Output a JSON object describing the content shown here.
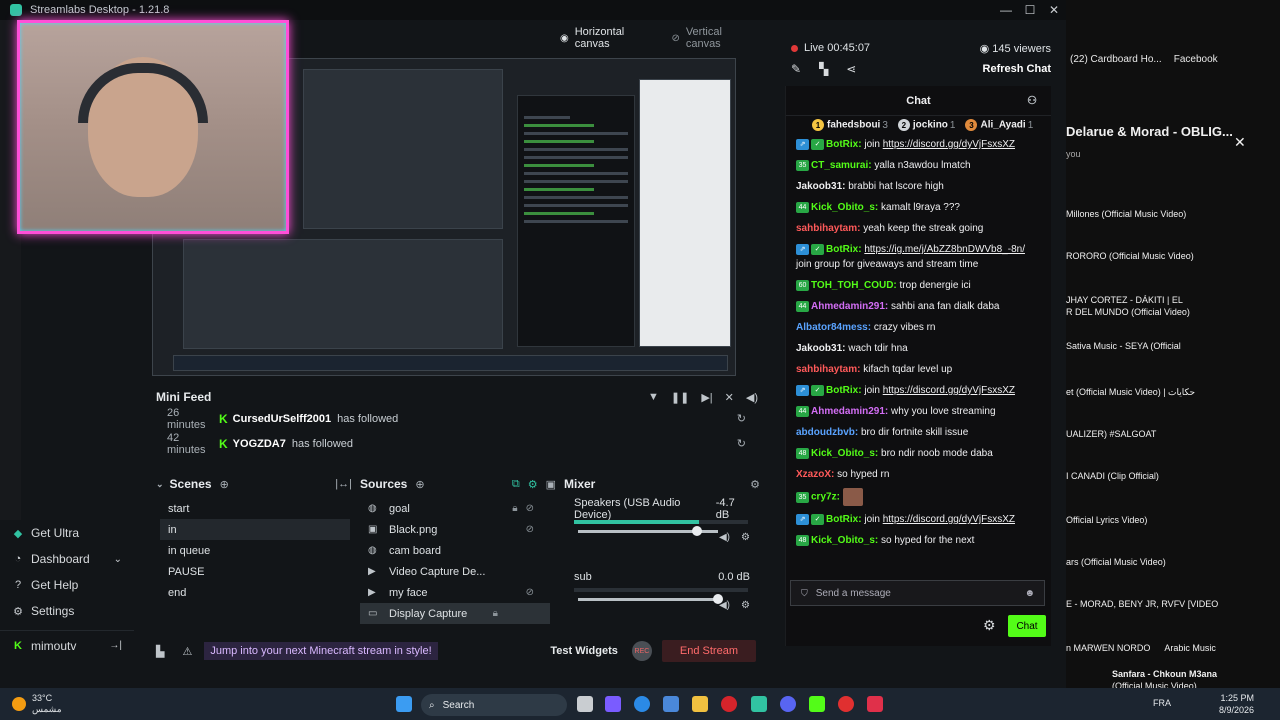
{
  "window": {
    "title": "Streamlabs Desktop - 1.21.8"
  },
  "canvas": {
    "horizontal": "Horizontal canvas",
    "vertical": "Vertical canvas"
  },
  "nav": {
    "items": [
      {
        "label": "Get Ultra",
        "icon": "ultra-icon"
      },
      {
        "label": "Dashboard",
        "icon": "dashboard-icon"
      },
      {
        "label": "Get Help",
        "icon": "help-icon"
      },
      {
        "label": "Settings",
        "icon": "gear-icon"
      }
    ],
    "user": "mimoutv"
  },
  "minifeed": {
    "title": "Mini Feed",
    "rows": [
      {
        "time": "26 minutes",
        "user": "CursedUrSelff2001",
        "action": "has followed"
      },
      {
        "time": "42 minutes",
        "user": "YOGZDA7",
        "action": "has followed"
      }
    ]
  },
  "scenes": {
    "title": "Scenes",
    "items": [
      "start",
      "in",
      "in queue",
      "PAUSE",
      "end"
    ],
    "selected": "in"
  },
  "sources": {
    "title": "Sources",
    "items": [
      "goal",
      "Black.png",
      "cam board",
      "Video Capture De...",
      "my face",
      "Display Capture"
    ],
    "selected": "Display Capture"
  },
  "mixer": {
    "title": "Mixer",
    "channels": [
      {
        "name": "Speakers (USB Audio Device)",
        "db": "-4.7 dB",
        "level": 0.72,
        "volume": 0.85
      },
      {
        "name": "sub",
        "db": "0.0 dB",
        "level": 0.0,
        "volume": 1.0
      }
    ]
  },
  "footer": {
    "promo": "Jump into your next Minecraft stream in style!",
    "test_widgets": "Test Widgets",
    "rec": "REC",
    "end_stream": "End Stream"
  },
  "live": {
    "status": "Live 00:45:07",
    "viewers": "145 viewers",
    "refresh": "Refresh Chat"
  },
  "chat": {
    "title": "Chat",
    "leaders": [
      {
        "rank": "1",
        "name": "fahedsboui",
        "count": "3",
        "color": "#f5c542"
      },
      {
        "rank": "2",
        "name": "jockino",
        "count": "1",
        "color": "#d0d4d8"
      },
      {
        "rank": "3",
        "name": "Ali_Ayadi",
        "count": "1",
        "color": "#e08a3c"
      }
    ],
    "messages": [
      {
        "badge": "",
        "user": "BotRix",
        "color": "#53fc18",
        "text": "join ",
        "link": "https://discord.gg/dyVjFsxsXZ",
        "bot": true
      },
      {
        "badge": "35",
        "user": "CT_samurai",
        "color": "#53fc18",
        "text": "yalla n3awdou lmatch"
      },
      {
        "badge": "",
        "user": "Jakoob31",
        "color": "#efeff1",
        "text": "brabbi hat lscore high"
      },
      {
        "badge": "44",
        "user": "Kick_Obito_s",
        "color": "#53fc18",
        "text": "kamalt l9raya ???"
      },
      {
        "badge": "",
        "user": "sahbihaytam",
        "color": "#ff5a5a",
        "text": "yeah keep the streak going"
      },
      {
        "badge": "",
        "user": "BotRix",
        "color": "#53fc18",
        "text": "",
        "link": "https://ig.me/j/AbZZ8bnDWVb8_-8n/",
        "after": " join group for giveaways and stream time",
        "bot": true
      },
      {
        "badge": "60",
        "user": "TOH_TOH_COUD",
        "color": "#53fc18",
        "text": "trop denergie ici"
      },
      {
        "badge": "44",
        "user": "Ahmedamin291",
        "color": "#d36ef5",
        "text": "sahbi ana fan dialk daba"
      },
      {
        "badge": "",
        "user": "Albator84mess",
        "color": "#5aa3ff",
        "text": "crazy vibes rn"
      },
      {
        "badge": "",
        "user": "Jakoob31",
        "color": "#efeff1",
        "text": "wach tdir hna"
      },
      {
        "badge": "",
        "user": "sahbihaytam",
        "color": "#ff5a5a",
        "text": "kifach tqdar level up"
      },
      {
        "badge": "",
        "user": "BotRix",
        "color": "#53fc18",
        "text": "join ",
        "link": "https://discord.gg/dyVjFsxsXZ",
        "bot": true
      },
      {
        "badge": "44",
        "user": "Ahmedamin291",
        "color": "#d36ef5",
        "text": "why you love streaming"
      },
      {
        "badge": "",
        "user": "abdoudzbvb",
        "color": "#5aa3ff",
        "text": "bro dir fortnite skill issue"
      },
      {
        "badge": "48",
        "user": "Kick_Obito_s",
        "color": "#53fc18",
        "text": "bro ndir noob mode daba"
      },
      {
        "badge": "",
        "user": "XzazoX",
        "color": "#ff5a5a",
        "text": "so hyped rn"
      },
      {
        "badge": "35",
        "user": "cry7z",
        "color": "#53fc18",
        "text": ""
      },
      {
        "badge": "",
        "user": "BotRix",
        "color": "#53fc18",
        "text": "join ",
        "link": "https://discord.gg/dyVjFsxsXZ",
        "bot": true
      },
      {
        "badge": "48",
        "user": "Kick_Obito_s",
        "color": "#53fc18",
        "text": "so hyped for the next"
      }
    ],
    "input_placeholder": "Send a message",
    "send_label": "Chat"
  },
  "browser": {
    "tabs": [
      "(22) Cardboard Ho...",
      "Facebook"
    ],
    "heading": "Delarue & Morad - OBLIG...",
    "subtitle": "you",
    "items": [
      "Millones (Official Music Video)",
      "RORORO (Official Music Video)",
      "JHAY CORTEZ - DÁKITI | EL",
      "R DEL MUNDO (Official Video)",
      "Sativa Music - SEYA (Official",
      "et (Official Music Video) | حكايات",
      "UALIZER) #SALGOAT",
      "I CANADI (Clip Official)",
      "Official Lyrics Video)",
      "ars (Official Music Video)",
      "E - MORAD, BENY JR, RVFV [VIDEO"
    ],
    "chips": [
      "n MARWEN NORDO",
      "Arabic Music"
    ],
    "mini_title": "Sanfara - Chkoun M3ana",
    "mini_sub": "(Official Music Video)"
  },
  "taskbar": {
    "temp": "33°C",
    "weather": "مشمس",
    "search": "Search",
    "lang": "FRA",
    "time": "1:25 PM",
    "date": "8/9/2026"
  }
}
